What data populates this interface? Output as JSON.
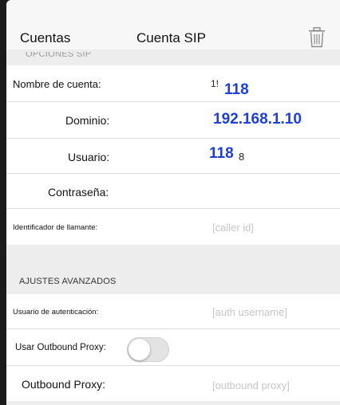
{
  "nav": {
    "back_label": "Cuentas",
    "title": "Cuenta SIP",
    "trash_icon": "trash-icon"
  },
  "section_top": {
    "label": "OPCIONES SIP"
  },
  "account_name": {
    "label": "Nombre de cuenta:",
    "value_partial": "1!",
    "overlay": "118"
  },
  "domain": {
    "label": "Dominio:",
    "value": "192.168.1.10"
  },
  "user": {
    "label": "Usuario:",
    "overlay": "118",
    "value_suffix": "8"
  },
  "password": {
    "label": "Contraseña:",
    "value": ""
  },
  "caller_id": {
    "label": "Identificador de llamante:",
    "placeholder": "[caller id]"
  },
  "advanced": {
    "header": "AJUSTES AVANZADOS"
  },
  "auth_user": {
    "label": "Usuario de autenticación:",
    "placeholder": "[auth username]"
  },
  "outbound_toggle": {
    "label": "Usar Outbound Proxy:",
    "state": "off"
  },
  "outbound_proxy": {
    "label": "Outbound Proxy:",
    "placeholder": "[outbound proxy]"
  },
  "colors": {
    "accent_blue": "#1b3ee8",
    "placeholder_gray": "#c6c6c6",
    "panel_bg": "#ededed"
  }
}
